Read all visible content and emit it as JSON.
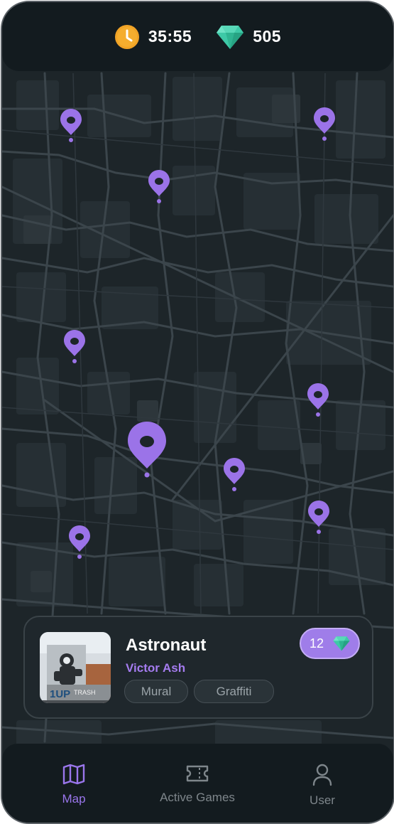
{
  "status": {
    "timer_icon": "clock-icon",
    "timer": "35:55",
    "gems_icon": "gem-icon",
    "gems": "505"
  },
  "map": {
    "pin_icon": "map-pin-icon",
    "pin_color": "#9b73e8"
  },
  "card": {
    "title": "Astronaut",
    "artist": "Victor Ash",
    "tags": [
      "Mural",
      "Graffiti"
    ],
    "reward": "12",
    "reward_icon": "gem-icon"
  },
  "nav": {
    "items": [
      {
        "label": "Map",
        "icon": "map-icon",
        "active": true
      },
      {
        "label": "Active Games",
        "icon": "ticket-icon",
        "active": false
      },
      {
        "label": "User",
        "icon": "user-icon",
        "active": false
      }
    ]
  },
  "colors": {
    "accent": "#9b73e8",
    "background": "#1c2428",
    "panel": "#131b1f"
  }
}
